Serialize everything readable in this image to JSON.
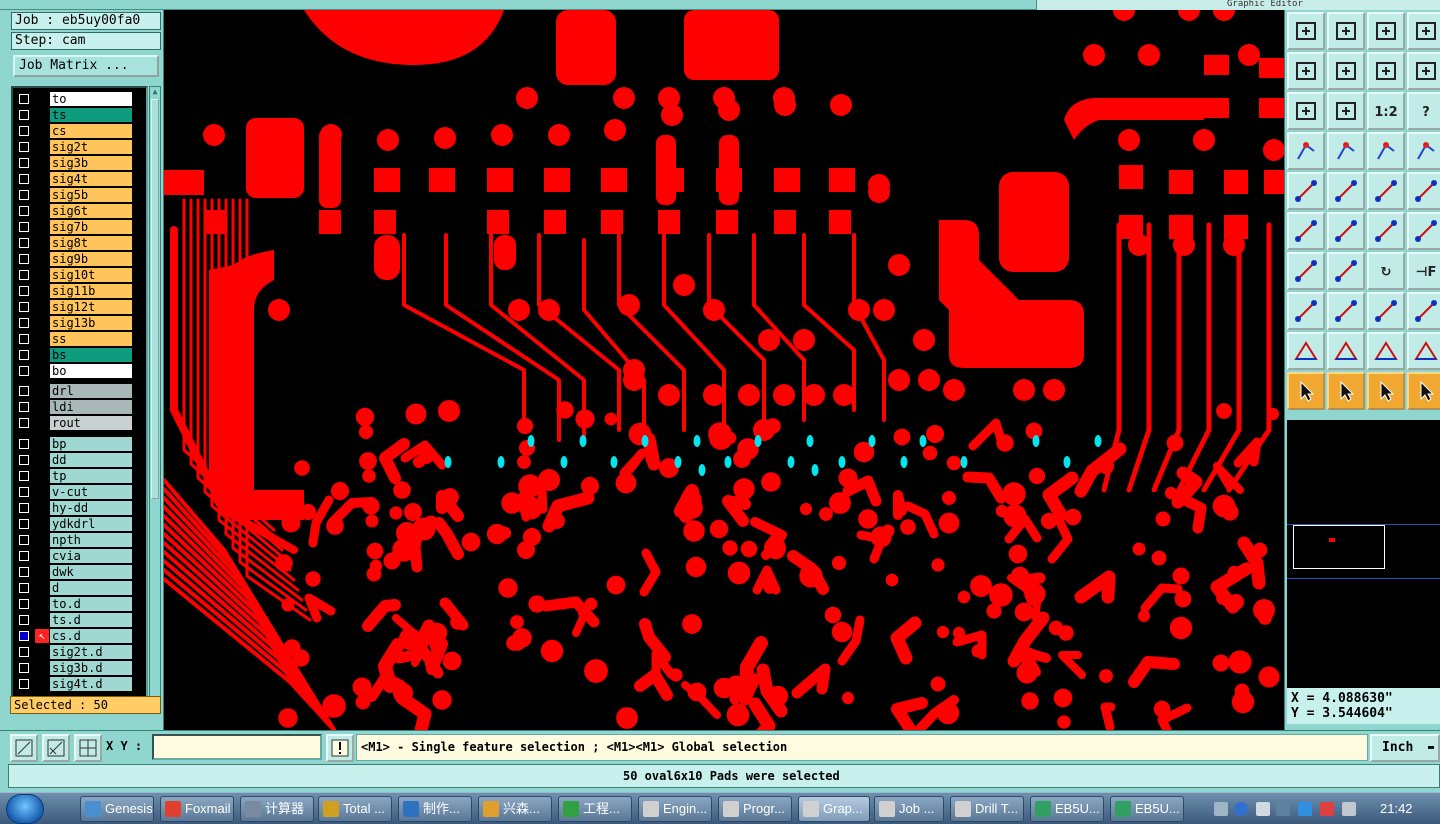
{
  "job": {
    "job_label": "Job : eb5uy00fa0",
    "step_label": "Step: cam",
    "matrix_button": "Job Matrix ..."
  },
  "topbar": {
    "right_title": "Graphic Editor"
  },
  "layers_board": [
    {
      "name": "to",
      "color": "#ffffff",
      "mark": "✎"
    },
    {
      "name": "ts",
      "color": "#0f9c7e",
      "mark": ""
    },
    {
      "name": "cs",
      "color": "#ffc45a",
      "mark": ""
    },
    {
      "name": "sig2t",
      "color": "#ffc45a",
      "mark": ""
    },
    {
      "name": "sig3b",
      "color": "#ffc45a",
      "mark": ""
    },
    {
      "name": "sig4t",
      "color": "#ffc45a",
      "mark": ""
    },
    {
      "name": "sig5b",
      "color": "#ffc45a",
      "mark": ""
    },
    {
      "name": "sig6t",
      "color": "#ffc45a",
      "mark": ""
    },
    {
      "name": "sig7b",
      "color": "#ffc45a",
      "mark": ""
    },
    {
      "name": "sig8t",
      "color": "#ffc45a",
      "mark": ""
    },
    {
      "name": "sig9b",
      "color": "#ffc45a",
      "mark": ""
    },
    {
      "name": "sig10t",
      "color": "#ffc45a",
      "mark": ""
    },
    {
      "name": "sig11b",
      "color": "#ffc45a",
      "mark": ""
    },
    {
      "name": "sig12t",
      "color": "#ffc45a",
      "mark": ""
    },
    {
      "name": "sig13b",
      "color": "#ffc45a",
      "mark": ""
    },
    {
      "name": "ss",
      "color": "#ffc45a",
      "mark": ""
    },
    {
      "name": "bs",
      "color": "#0f9c7e",
      "mark": ""
    },
    {
      "name": "bo",
      "color": "#ffffff",
      "mark": "✎"
    }
  ],
  "layers_drill": [
    {
      "name": "drl",
      "color": "#a8b8b8",
      "mark": ""
    },
    {
      "name": "ldi",
      "color": "#a8b8b8",
      "mark": ""
    },
    {
      "name": "rout",
      "color": "#c8d0d0",
      "mark": ""
    }
  ],
  "layers_misc": [
    {
      "name": "bp",
      "color": "#9fd8d2",
      "mark": ""
    },
    {
      "name": "dd",
      "color": "#9fd8d2",
      "mark": ""
    },
    {
      "name": "tp",
      "color": "#9fd8d2",
      "mark": ""
    },
    {
      "name": "v-cut",
      "color": "#9fd8d2",
      "mark": ""
    },
    {
      "name": "hy-dd",
      "color": "#9fd8d2",
      "mark": ""
    },
    {
      "name": "ydkdrl",
      "color": "#9fd8d2",
      "mark": ""
    },
    {
      "name": "npth",
      "color": "#9fd8d2",
      "mark": ""
    },
    {
      "name": "cvia",
      "color": "#9fd8d2",
      "mark": ""
    },
    {
      "name": "dwk",
      "color": "#9fd8d2",
      "mark": ""
    },
    {
      "name": "d",
      "color": "#9fd8d2",
      "mark": ""
    },
    {
      "name": "to.d",
      "color": "#9fd8d2",
      "mark": "✎"
    },
    {
      "name": "ts.d",
      "color": "#9fd8d2",
      "mark": ""
    },
    {
      "name": "cs.d",
      "color": "#9fd8d2",
      "mark": "⊞",
      "selected": true
    },
    {
      "name": "sig2t.d",
      "color": "#9fd8d2",
      "mark": ""
    },
    {
      "name": "sig3b.d",
      "color": "#9fd8d2",
      "mark": ""
    },
    {
      "name": "sig4t.d",
      "color": "#9fd8d2",
      "mark": ""
    }
  ],
  "selected_label": "Selected : 50",
  "coords": {
    "x": "X = 4.088630\"",
    "y": "Y = 3.544604\""
  },
  "cmd": {
    "xy_label": "X Y :",
    "xy_value": "",
    "message": "<M1> - Single feature selection ; <M1><M1> Global selection",
    "units": "Inch"
  },
  "status_message": "50 oval6x10 Pads were selected",
  "colors": {
    "trace": "#ff0000",
    "selected_pad": "#00e5ee",
    "background": "#000000"
  },
  "toolbar_icons": [
    "zoom-home-icon",
    "zoom-back-icon",
    "home-icon",
    "window-icon",
    "pan-left-icon",
    "pan-right-icon",
    "undo-zoom-icon",
    "redo-zoom-icon",
    "fit-all-icon",
    "center-icon",
    "scale-1to2-icon",
    "help-icon",
    "tools-icon",
    "probe-icon",
    "net-highlight-icon",
    "net-select-icon",
    "snap-icon",
    "rect-select-icon",
    "ruler-icon",
    "pad-icon",
    "polyline-icon",
    "cross-icon",
    "add-point-icon",
    "move-point-icon",
    "line-icon",
    "slash-line-icon",
    "arc-icon",
    "text-icon",
    "measure-icon",
    "dash-icon",
    "dimension-icon",
    "fill-icon",
    "triangle-icon",
    "triangle-point-icon",
    "triangle-arc-icon",
    "triangle-wave-icon",
    "select-pointer-icon",
    "select-pointer-alt-icon",
    "select-radius-icon",
    "select-connect-icon"
  ],
  "taskbar": {
    "items": [
      {
        "label": "Genesis",
        "color": "#4a90d0"
      },
      {
        "label": "Foxmail",
        "color": "#e04030"
      },
      {
        "label": "计算器",
        "color": "#7a8aa0"
      },
      {
        "label": "Total ...",
        "color": "#d0a020"
      },
      {
        "label": "制作...",
        "color": "#3070c0"
      },
      {
        "label": "兴森...",
        "color": "#e0a030"
      },
      {
        "label": "工程...",
        "color": "#30a040"
      },
      {
        "label": "Engin...",
        "color": "#d0d0d0"
      },
      {
        "label": "Progr...",
        "color": "#d0d0d0"
      },
      {
        "label": "Grap...",
        "color": "#d0d0d0",
        "active": true
      },
      {
        "label": "Job ...",
        "color": "#d0d0d0"
      },
      {
        "label": "Drill T...",
        "color": "#d0d0d0"
      },
      {
        "label": "EB5U...",
        "color": "#30a060"
      },
      {
        "label": "EB5U...",
        "color": "#30a060"
      }
    ],
    "clock": "21:42"
  }
}
